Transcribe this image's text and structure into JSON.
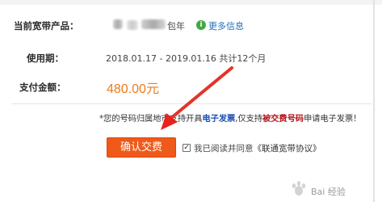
{
  "plan": {
    "label": "当前宽带产品：",
    "name_suffix": "包年",
    "more_info_icon": "info-icon",
    "more_info_label": "更多信息"
  },
  "period": {
    "label": "使用期：",
    "value": "2018.01.17 - 2019.01.16 共计12个月"
  },
  "payment": {
    "label": "支付金额：",
    "amount": "480.00元"
  },
  "notice": {
    "prefix": "*您的号码归属地市支持开具",
    "invoice_link": "电子发票",
    "middle": ",仅支持",
    "payer_number": "被交费号码",
    "suffix": "申请电子发票！"
  },
  "actions": {
    "confirm_label": "确认交费",
    "agree_checked": true,
    "agree_prefix": "我已阅读并同意",
    "agreement_link": "《联通宽带协议》"
  },
  "watermark": {
    "text": "Bai 经验",
    "icon": "baidu-paw-icon"
  },
  "colors": {
    "price": "#ee7a1b",
    "confirm_button": "#ef5a1a",
    "link_blue": "#1d4fb3",
    "link_red": "#b5161c",
    "arrow_red": "#e8231c",
    "info_green": "#41a843"
  }
}
